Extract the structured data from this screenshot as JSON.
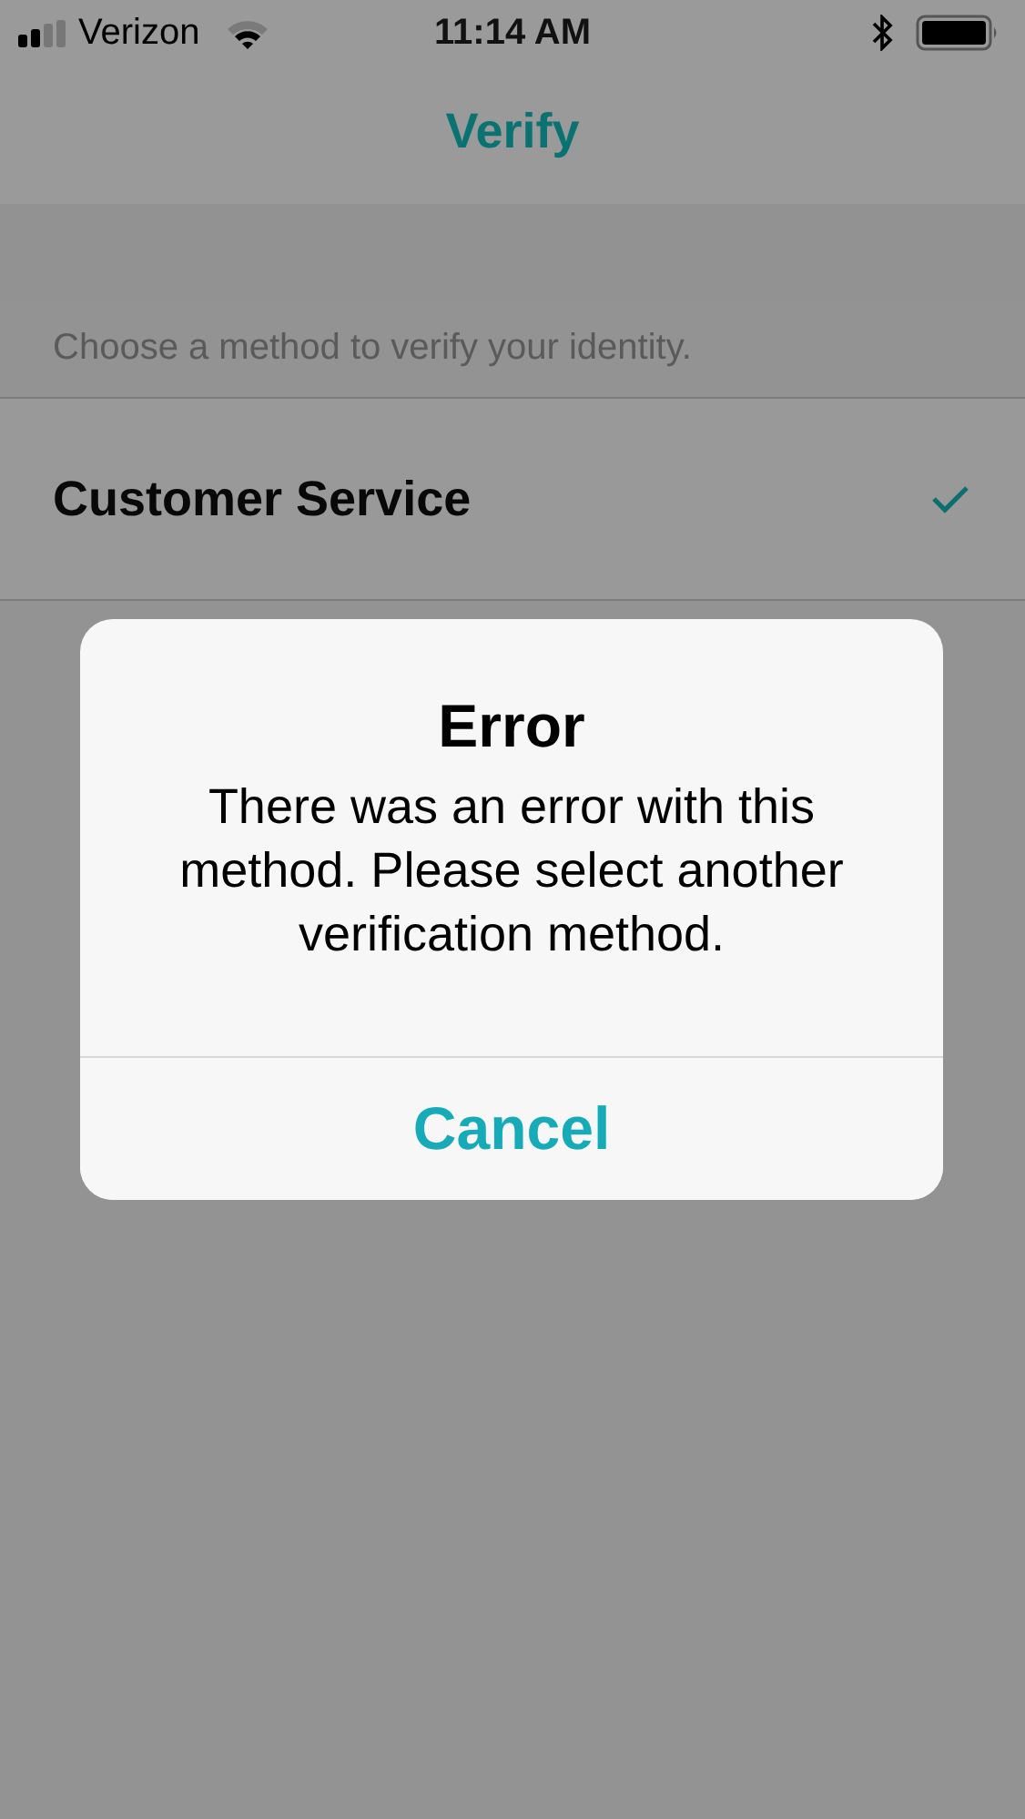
{
  "status_bar": {
    "carrier": "Verizon",
    "time": "11:14 AM"
  },
  "nav": {
    "title": "Verify"
  },
  "section_header": "Choose a method to verify your identity.",
  "methods": [
    {
      "label": "Customer Service",
      "selected": true
    }
  ],
  "alert": {
    "title": "Error",
    "message": "There was an error with this method. Please select another verification method.",
    "buttons": [
      "Cancel"
    ]
  }
}
